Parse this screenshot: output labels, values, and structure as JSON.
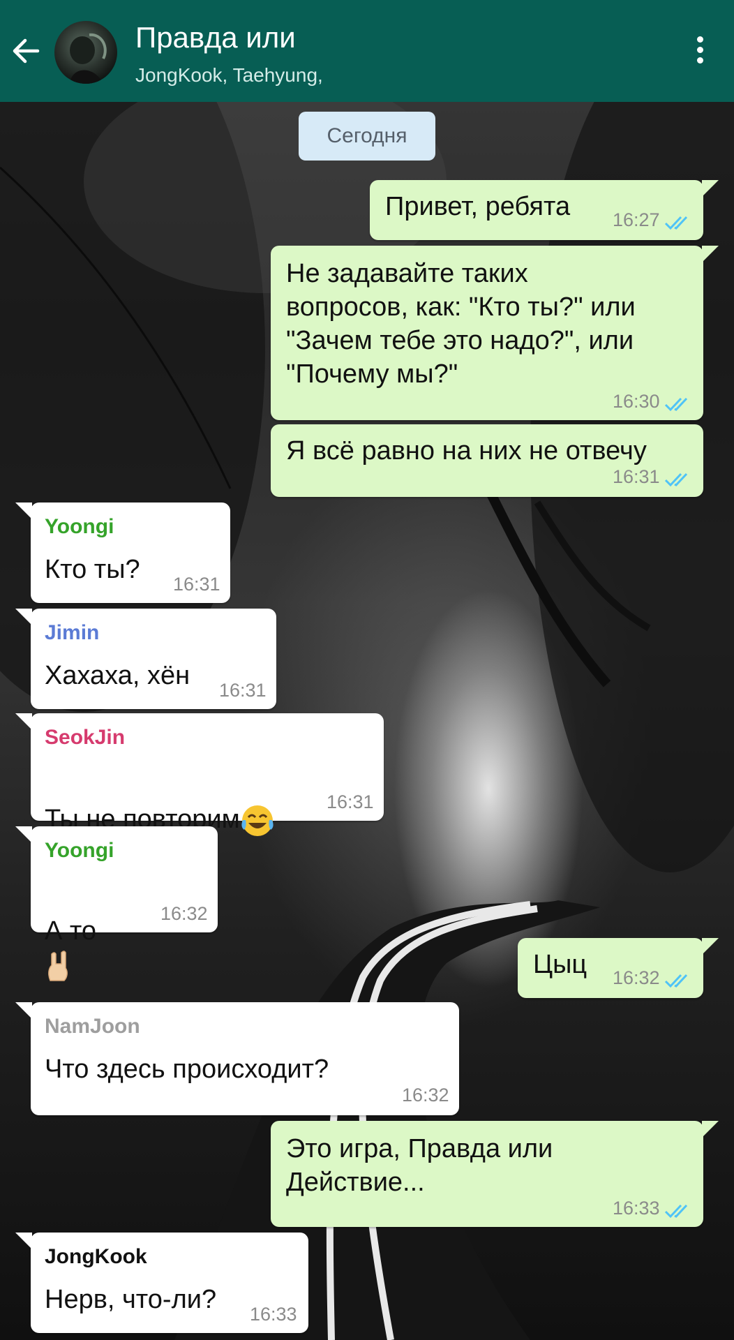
{
  "header": {
    "title": "Правда или",
    "subtitle": "JongKook, Taehyung,",
    "background_color": "#075e54",
    "back_icon": "arrow-left-icon",
    "menu_icon": "kebab-menu-icon"
  },
  "date_divider": "Сегодня",
  "colors": {
    "outgoing_bubble": "#dcf8c6",
    "incoming_bubble": "#ffffff",
    "read_ticks": "#4fc3f7",
    "sender_yoongi": "#35a32a",
    "sender_jimin": "#5b7bd5",
    "sender_seokjin": "#d63b6e",
    "sender_namjoon": "#9e9e9e",
    "sender_jongkook": "#111111"
  },
  "messages": [
    {
      "direction": "out",
      "text": "Привет, ребята",
      "time": "16:27",
      "status": "read"
    },
    {
      "direction": "out",
      "text": "Не задавайте таких\nвопросов, как: \"Кто ты?\" или\n\"Зачем тебе это надо?\", или\n\"Почему мы?\"",
      "time": "16:30",
      "status": "read"
    },
    {
      "direction": "out",
      "text": "Я всё равно на них не отвечу",
      "time": "16:31",
      "status": "read"
    },
    {
      "direction": "in",
      "sender": "Yoongi",
      "text": "Кто ты?",
      "time": "16:31"
    },
    {
      "direction": "in",
      "sender": "Jimin",
      "text": "Хахаха, хён",
      "time": "16:31"
    },
    {
      "direction": "in",
      "sender": "SeokJin",
      "text": "Ты не повторим",
      "emoji": "tears-of-joy-emoji",
      "time": "16:31"
    },
    {
      "direction": "in",
      "sender": "Yoongi",
      "text": "А то",
      "emoji": "rock-hand-emoji",
      "time": "16:32"
    },
    {
      "direction": "out",
      "text": "Цыц",
      "time": "16:32",
      "status": "read"
    },
    {
      "direction": "in",
      "sender": "NamJoon",
      "text": "Что здесь происходит?",
      "time": "16:32"
    },
    {
      "direction": "out",
      "text": "Это игра, Правда или\nДействие...",
      "time": "16:33",
      "status": "read"
    },
    {
      "direction": "in",
      "sender": "JongKook",
      "text": "Нерв, что-ли?",
      "time": "16:33"
    }
  ]
}
